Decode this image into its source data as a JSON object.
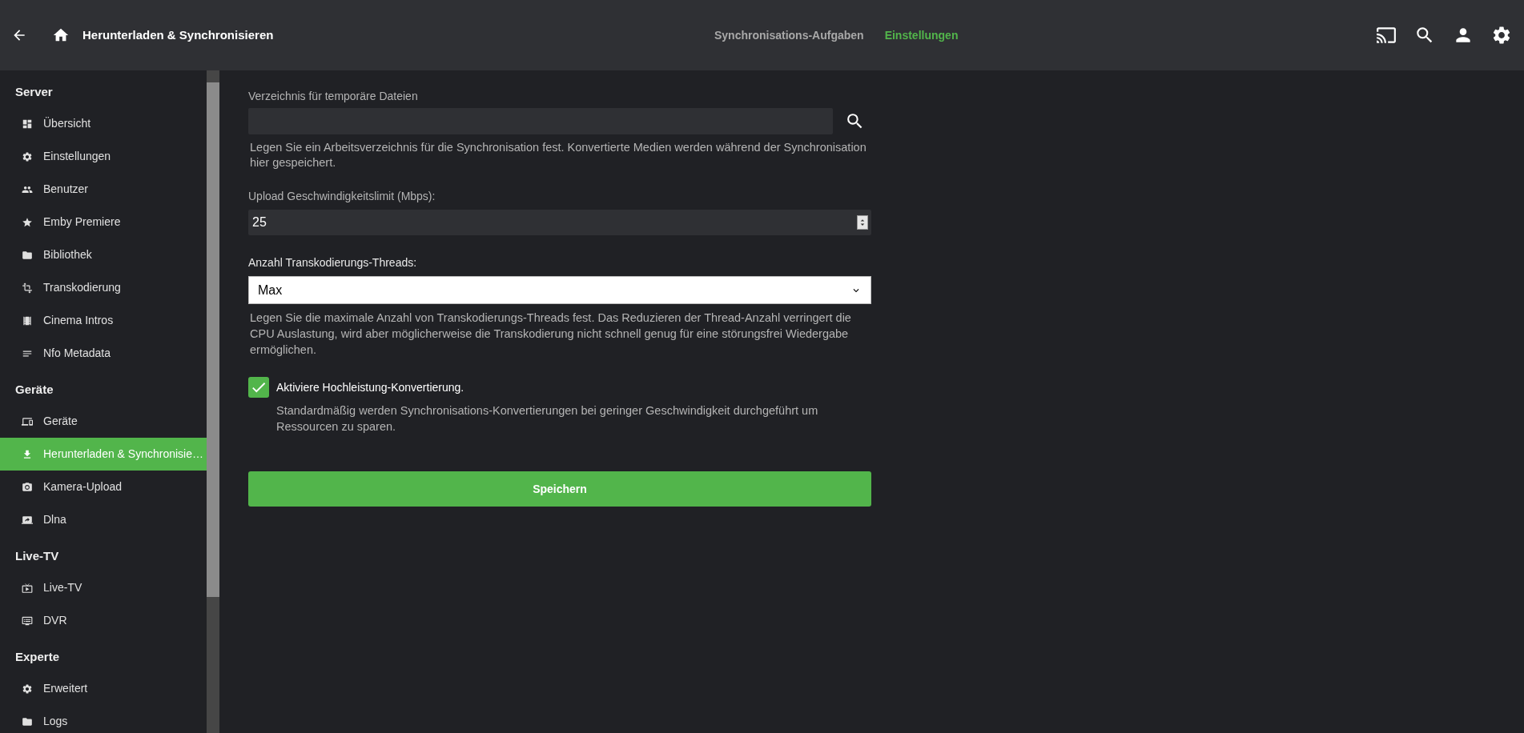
{
  "header": {
    "title": "Herunterladen & Synchronisieren"
  },
  "tabs": [
    {
      "label": "Synchronisations-Aufgaben",
      "selected": false
    },
    {
      "label": "Einstellungen",
      "selected": true
    }
  ],
  "sidebar": {
    "sections": [
      {
        "heading": "Server",
        "items": [
          {
            "label": "Übersicht",
            "selected": false
          },
          {
            "label": "Einstellungen",
            "selected": false
          },
          {
            "label": "Benutzer",
            "selected": false
          },
          {
            "label": "Emby Premiere",
            "selected": false
          },
          {
            "label": "Bibliothek",
            "selected": false
          },
          {
            "label": "Transkodierung",
            "selected": false
          },
          {
            "label": "Cinema Intros",
            "selected": false
          },
          {
            "label": "Nfo Metadata",
            "selected": false
          }
        ]
      },
      {
        "heading": "Geräte",
        "items": [
          {
            "label": "Geräte",
            "selected": false
          },
          {
            "label": "Herunterladen & Synchronisie…",
            "selected": true
          },
          {
            "label": "Kamera-Upload",
            "selected": false
          },
          {
            "label": "Dlna",
            "selected": false
          }
        ]
      },
      {
        "heading": "Live-TV",
        "items": [
          {
            "label": "Live-TV",
            "selected": false
          },
          {
            "label": "DVR",
            "selected": false
          }
        ]
      },
      {
        "heading": "Experte",
        "items": [
          {
            "label": "Erweitert",
            "selected": false
          },
          {
            "label": "Logs",
            "selected": false
          }
        ]
      }
    ]
  },
  "form": {
    "temp_dir": {
      "label": "Verzeichnis für temporäre Dateien",
      "help": "Legen Sie ein Arbeitsverzeichnis für die Synchronisation fest. Konvertierte Medien werden während der Synchronisation hier gespeichert."
    },
    "upload_limit": {
      "label": "Upload Geschwindigkeitslimit (Mbps):",
      "value": "25"
    },
    "threads": {
      "label": "Anzahl Transkodierungs-Threads:",
      "value": "Max",
      "help": "Legen Sie die maximale Anzahl von Transkodierungs-Threads fest. Das Reduzieren der Thread-Anzahl verringert die CPU Auslastung, wird aber möglicherweise die Transkodierung nicht schnell genug für eine störungsfrei Wiedergabe ermöglichen."
    },
    "high_performance": {
      "label": "Aktiviere Hochleistung-Konvertierung.",
      "checked": true,
      "help": "Standardmäßig werden Synchronisations-Konvertierungen bei geringer Geschwindigkeit durchgeführt um Ressourcen zu sparen."
    },
    "save_button": "Speichern"
  }
}
